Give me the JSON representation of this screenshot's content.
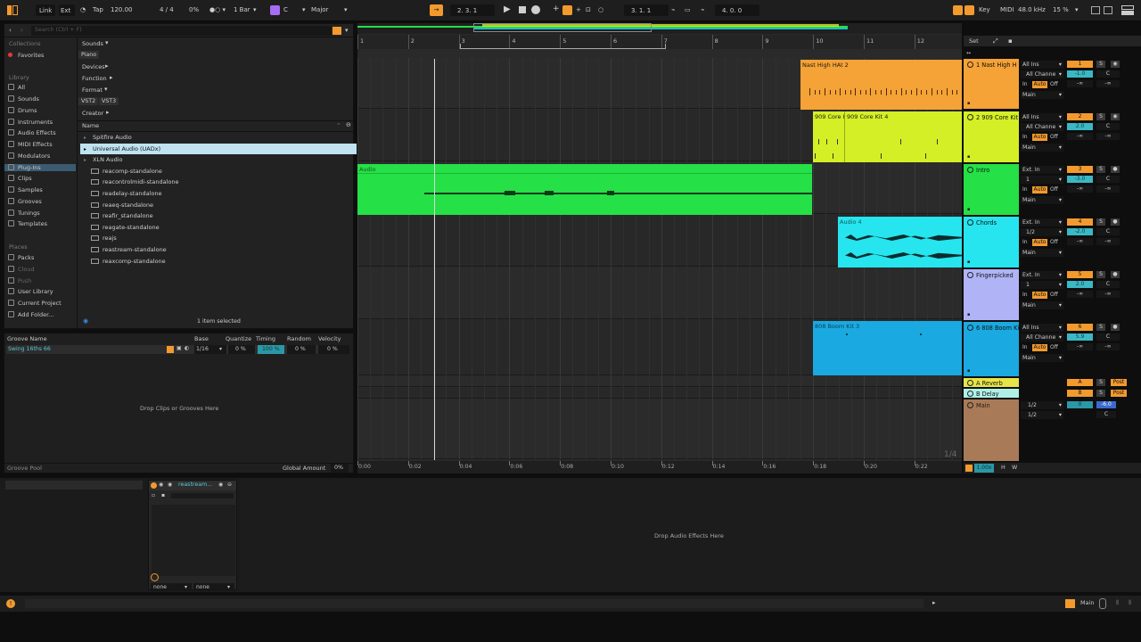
{
  "transport": {
    "link": "Link",
    "ext": "Ext",
    "tap": "Tap",
    "tempo": "120.00",
    "signature": "4 / 4",
    "groove_pct": "0%",
    "quantize": "1 Bar",
    "key": "C",
    "scale": "Major",
    "position": "2.  3.  1",
    "loop_start": "3.  1.  1",
    "loop_len": "4.  0.  0",
    "key_label": "Key",
    "midi_label": "MIDI",
    "sample_rate": "48.0 kHz",
    "cpu": "15 %"
  },
  "browser": {
    "search_placeholder": "Search (Ctrl + F)",
    "collections_head": "Collections",
    "favorites": "Favorites",
    "library_head": "Library",
    "library_items": [
      "All",
      "Sounds",
      "Drums",
      "Instruments",
      "Audio Effects",
      "MIDI Effects",
      "Modulators",
      "Plug-Ins",
      "Clips",
      "Samples",
      "Grooves",
      "Tunings",
      "Templates"
    ],
    "places_head": "Places",
    "places_items": [
      "Packs",
      "Cloud",
      "Push",
      "User Library",
      "Current Project",
      "Add Folder..."
    ],
    "filters": {
      "sounds": "Sounds",
      "piano": "Piano",
      "devices": "Devices",
      "function": "Function",
      "format": "Format",
      "vst2": "VST2",
      "vst3": "VST3",
      "creator": "Creator"
    },
    "name_col": "Name",
    "list": [
      {
        "label": "Spitfire Audio",
        "type": "folder"
      },
      {
        "label": "Universal Audio (UADx)",
        "type": "folder-selected"
      },
      {
        "label": "XLN Audio",
        "type": "folder"
      },
      {
        "label": "reacomp-standalone",
        "type": "file"
      },
      {
        "label": "reacontrolmidi-standalone",
        "type": "file"
      },
      {
        "label": "readelay-standalone",
        "type": "file"
      },
      {
        "label": "reaeq-standalone",
        "type": "file"
      },
      {
        "label": "reafir_standalone",
        "type": "file"
      },
      {
        "label": "reagate-standalone",
        "type": "file"
      },
      {
        "label": "reajs",
        "type": "file"
      },
      {
        "label": "reastream-standalone",
        "type": "file"
      },
      {
        "label": "reaxcomp-standalone",
        "type": "file"
      }
    ],
    "status": "1 item selected"
  },
  "groove_pool": {
    "headers": [
      "Groove Name",
      "Base",
      "Quantize",
      "Timing",
      "Random",
      "Velocity"
    ],
    "row": {
      "name": "Swing 16ths 66",
      "base": "1/16",
      "quantize": "0 %",
      "timing": "100 %",
      "random": "0 %",
      "velocity": "0 %"
    },
    "drop_text": "Drop Clips or Grooves Here",
    "footer": "Groove Pool",
    "global_amount_label": "Global Amount",
    "global_amount": "0%"
  },
  "arrangement": {
    "bars": [
      "1",
      "2",
      "3",
      "4",
      "5",
      "6",
      "7",
      "8",
      "9",
      "10",
      "11",
      "12"
    ],
    "times": [
      "0:00",
      "0:02",
      "0:04",
      "0:06",
      "0:08",
      "0:10",
      "0:12",
      "0:14",
      "0:16",
      "0:18",
      "0:20",
      "0:22"
    ],
    "zoom_fraction": "1/4",
    "set_label": "Set",
    "tempo_scale": "1.00x",
    "h_btn": "H",
    "w_btn": "W",
    "clips": [
      {
        "name": "Nast High HAt 2",
        "color": "#f5a236"
      },
      {
        "name": "909 Core K",
        "color": "#d4ef25"
      },
      {
        "name": "909 Core Kit 4",
        "color": "#d4ef25"
      },
      {
        "name": "Audio",
        "color": "#25e046"
      },
      {
        "name": "Audio 4",
        "color": "#26e5ee"
      },
      {
        "name": "808 Boom Kit 3",
        "color": "#1aa9e0"
      }
    ]
  },
  "tracks": [
    {
      "name": "1 Nast High H",
      "color": "#f5a236",
      "input": "All Ins",
      "channel": "All Channe",
      "mon": "In",
      "auto": "Auto",
      "off": "Off",
      "out": "Main",
      "num": "1",
      "vol": "-1.0",
      "pan": "C",
      "inf1": "-∞",
      "inf2": "-∞"
    },
    {
      "name": "2 909 Core Kit",
      "color": "#d4ef25",
      "input": "All Ins",
      "channel": "All Channe",
      "mon": "In",
      "auto": "Auto",
      "off": "Off",
      "out": "Main",
      "num": "2",
      "vol": "2.0",
      "pan": "C",
      "inf1": "-∞",
      "inf2": "-∞"
    },
    {
      "name": "Intro",
      "color": "#25e046",
      "input": "Ext. In",
      "channel": "1",
      "mon": "In",
      "auto": "Auto",
      "off": "Off",
      "out": "Main",
      "num": "3",
      "vol": "-3.0",
      "pan": "C",
      "inf1": "-∞",
      "inf2": "-∞"
    },
    {
      "name": "Chords",
      "color": "#26e5ee",
      "input": "Ext. In",
      "channel": "1/2",
      "mon": "In",
      "auto": "Auto",
      "off": "Off",
      "out": "Main",
      "num": "4",
      "vol": "-2.0",
      "pan": "C",
      "inf1": "-∞",
      "inf2": "-∞"
    },
    {
      "name": "Fingerpicked",
      "color": "#b0b4f6",
      "input": "Ext. In",
      "channel": "1",
      "mon": "In",
      "auto": "Auto",
      "off": "Off",
      "out": "Main",
      "num": "5",
      "vol": "2.0",
      "pan": "C",
      "inf1": "-∞",
      "inf2": "-∞"
    },
    {
      "name": "6 808 Boom Ki",
      "color": "#1aa9e0",
      "input": "All Ins",
      "channel": "All Channe",
      "mon": "In",
      "auto": "Auto",
      "off": "Off",
      "out": "Main",
      "num": "6",
      "vol": "5.9",
      "pan": "C",
      "inf1": "-∞",
      "inf2": "-∞"
    }
  ],
  "returns": [
    {
      "name": "A Reverb",
      "color": "#e6e44a",
      "letter": "A",
      "s": "S",
      "post": "Post"
    },
    {
      "name": "B Delay",
      "color": "#aef0e6",
      "letter": "B",
      "s": "S",
      "post": "Post"
    }
  ],
  "main_track": {
    "name": "Main",
    "color": "#a87a58",
    "in1": "1/2",
    "in2": "1/2",
    "vol": "0",
    "db": "-6.0",
    "pan": "C"
  },
  "device": {
    "name": "reastream...",
    "sel1": "none",
    "sel2": "none",
    "drop_text": "Drop Audio Effects Here"
  },
  "statusbar": {
    "main": "Main"
  }
}
